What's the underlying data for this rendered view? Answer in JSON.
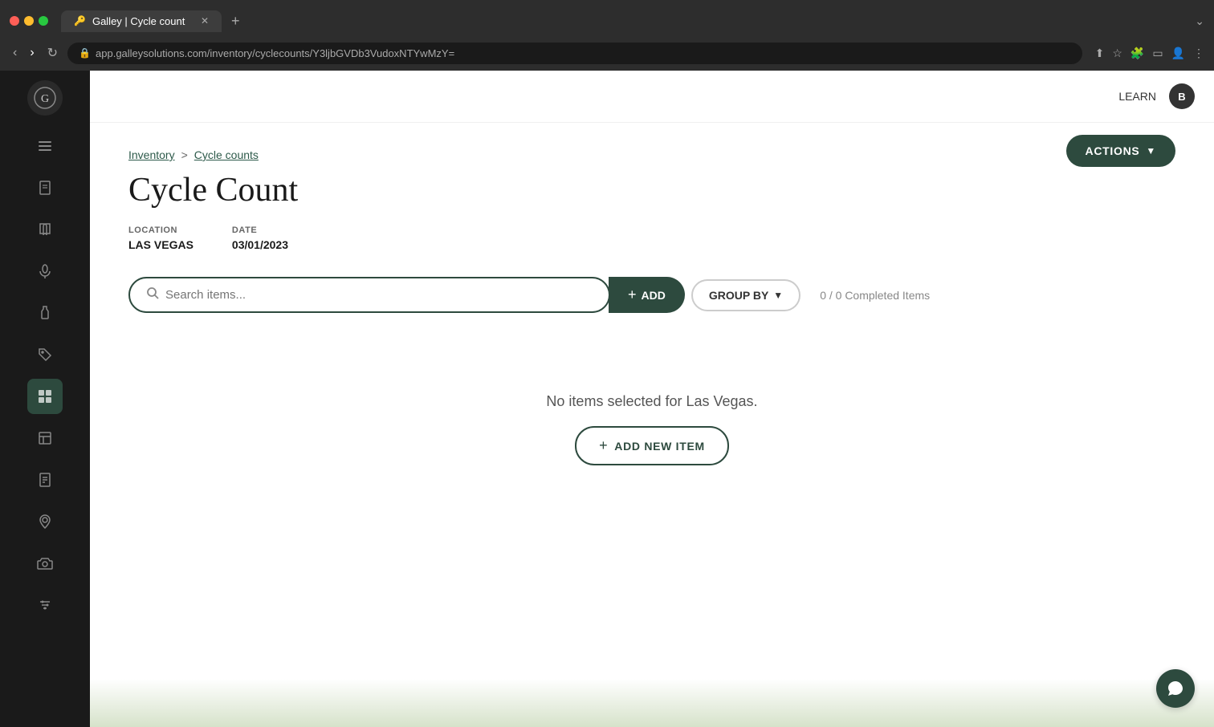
{
  "browser": {
    "tab_title": "Galley | Cycle count",
    "url_base": "app.galleysolutions.com",
    "url_path": "/inventory/cyclecounts/Y3ljbGVDb3VudoxNTYwMzY=",
    "new_tab_label": "+"
  },
  "header": {
    "learn_label": "LEARN",
    "user_initial": "B"
  },
  "breadcrumb": {
    "parent": "Inventory",
    "separator": ">",
    "current": "Cycle counts"
  },
  "page": {
    "title": "Cycle Count",
    "actions_label": "ACTIONS",
    "location_label": "LOCATION",
    "location_value": "LAS VEGAS",
    "date_label": "DATE",
    "date_value": "03/01/2023"
  },
  "toolbar": {
    "search_placeholder": "Search items...",
    "add_label": "ADD",
    "group_by_label": "GROUP BY",
    "completed_text": "0 / 0 Completed Items"
  },
  "empty_state": {
    "message": "No items selected for Las Vegas.",
    "add_new_label": "ADD NEW ITEM"
  },
  "sidebar": {
    "items": [
      {
        "name": "menu-icon",
        "unicode": "☰"
      },
      {
        "name": "document-icon",
        "unicode": "📄"
      },
      {
        "name": "book-icon",
        "unicode": "📖"
      },
      {
        "name": "microphone-icon",
        "unicode": "🎤"
      },
      {
        "name": "bottle-icon",
        "unicode": "🍾"
      },
      {
        "name": "tag-icon",
        "unicode": "🏷"
      },
      {
        "name": "list-icon",
        "unicode": "≡",
        "active": true
      },
      {
        "name": "grid-icon",
        "unicode": "▦"
      },
      {
        "name": "file-icon",
        "unicode": "📋"
      },
      {
        "name": "location-icon",
        "unicode": "📍"
      },
      {
        "name": "camera-icon",
        "unicode": "📷"
      },
      {
        "name": "settings-icon",
        "unicode": "⚙"
      }
    ]
  }
}
